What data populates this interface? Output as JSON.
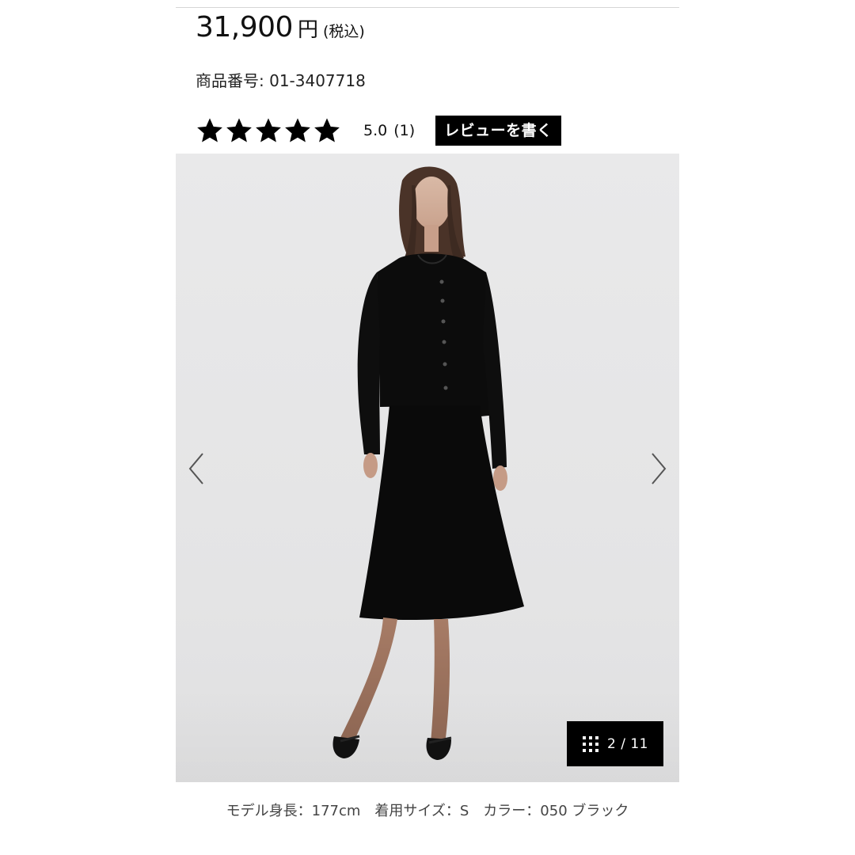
{
  "product": {
    "price": "31,900",
    "currency": "円",
    "tax_note": "(税込)",
    "sku_text": "商品番号: 01-3407718"
  },
  "rating": {
    "stars": 5,
    "max_stars": 5,
    "score": "5.0",
    "count": "(1)",
    "write_review_label": "レビューを書く"
  },
  "gallery": {
    "counter": "2 / 11",
    "prev_icon": "chevron-left-icon",
    "next_icon": "chevron-right-icon",
    "grid_icon": "grid-icon"
  },
  "caption": {
    "text": "モデル身長：177cm　着用サイズ：S　カラー：050 ブラック"
  }
}
